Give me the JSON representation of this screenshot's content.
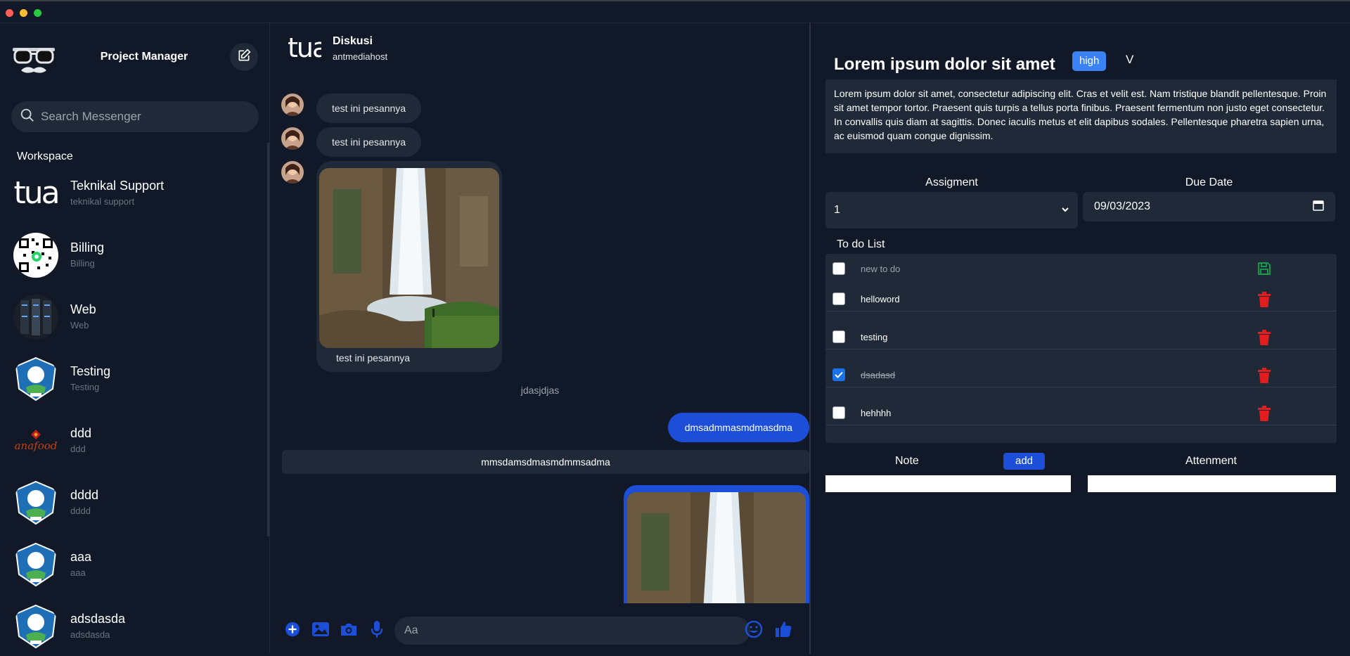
{
  "colors": {
    "accent": "#1d4ed8",
    "badge": "#3b82f6",
    "danger": "#e11d1d",
    "success": "#16a34a"
  },
  "sidebar": {
    "title": "Project Manager",
    "search_placeholder": "Search Messenger",
    "section_label": "Workspace",
    "conversations": [
      {
        "name": "Teknikal Support",
        "sub": "teknikal support",
        "avatar": "tua-logo"
      },
      {
        "name": "Billing",
        "sub": "Billing",
        "avatar": "qr-code"
      },
      {
        "name": "Web",
        "sub": "Web",
        "avatar": "server-rack"
      },
      {
        "name": "Testing",
        "sub": "Testing",
        "avatar": "emblem"
      },
      {
        "name": "ddd",
        "sub": "ddd",
        "avatar": "anafood-logo",
        "avatar_text": "anafood"
      },
      {
        "name": "dddd",
        "sub": "dddd",
        "avatar": "emblem"
      },
      {
        "name": "aaa",
        "sub": "aaa",
        "avatar": "emblem"
      },
      {
        "name": "adsdasda",
        "sub": "adsdasda",
        "avatar": "emblem"
      }
    ]
  },
  "chat": {
    "avatar_text": "tua",
    "title": "Diskusi",
    "subtitle": "antmediahost",
    "messages": {
      "m1": "test ini pesannya",
      "m2": "test ini pesannya",
      "m3_caption": "test ini pesannya",
      "system": "jdasjdjas",
      "outgoing": "dmsadmmasmdmasdma",
      "wide": "mmsdamsdmasmdmmsadma"
    },
    "composer_placeholder": "Aa"
  },
  "task": {
    "title": "Lorem ipsum dolor sit amet",
    "priority": "high",
    "priority_toggle": "V",
    "description": "Lorem ipsum dolor sit amet, consectetur adipiscing elit. Cras et velit est. Nam tristique blandit pellentesque. Proin sit amet tempor tortor. Praesent quis turpis a tellus porta finibus. Praesent fermentum non justo eget consectetur. In convallis quis diam at sagittis. Donec iaculis metus et elit dapibus sodales. Pellentesque pharetra sapien urna, ac euismod quam congue dignissim.",
    "assignment_label": "Assigment",
    "assignment_value": "1",
    "due_label": "Due Date",
    "due_value": "09/03/2023",
    "todo_label": "To do List",
    "new_todo_placeholder": "new to do",
    "todos": [
      {
        "text": "helloword",
        "done": false
      },
      {
        "text": "testing",
        "done": false
      },
      {
        "text": "dsadasd",
        "done": true
      },
      {
        "text": "hehhhh",
        "done": false
      }
    ],
    "note_label": "Note",
    "add_label": "add",
    "attachment_label": "Attenment"
  }
}
